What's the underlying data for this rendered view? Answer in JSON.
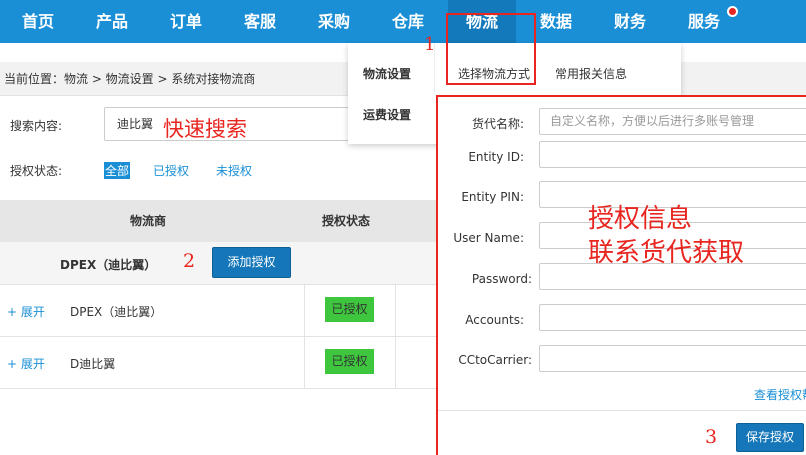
{
  "nav": {
    "items": [
      "首页",
      "产品",
      "订单",
      "客服",
      "采购",
      "仓库",
      "物流",
      "数据",
      "财务",
      "服务"
    ],
    "active_index": 6
  },
  "breadcrumb": "当前位置：物流 > 物流设置 > 系统对接物流商",
  "search": {
    "label": "搜索内容:",
    "value": "迪比翼"
  },
  "auth_filter": {
    "label": "授权状态:",
    "options": [
      "全部",
      "已授权",
      "未授权"
    ],
    "selected_index": 0
  },
  "table": {
    "headers": [
      "物流商",
      "授权状态"
    ],
    "group": {
      "name": "DPEX（迪比翼）",
      "add_button": "添加授权"
    },
    "rows": [
      {
        "expand": "+ 展开",
        "name": "DPEX（迪比翼）",
        "status": "已授权"
      },
      {
        "expand": "+ 展开",
        "name": "D迪比翼",
        "status": "已授权"
      }
    ]
  },
  "dropdown": {
    "col1": [
      "物流设置",
      "运费设置"
    ],
    "col2": [
      "选择物流方式",
      "常用报关信息"
    ]
  },
  "form": {
    "fields": [
      {
        "label": "货代名称:",
        "placeholder": "自定义名称，方便以后进行多账号管理"
      },
      {
        "label": "Entity ID:",
        "placeholder": ""
      },
      {
        "label": "Entity PIN:",
        "placeholder": ""
      },
      {
        "label": "User Name:",
        "placeholder": ""
      },
      {
        "label": "Password:",
        "placeholder": ""
      },
      {
        "label": "Accounts:",
        "placeholder": ""
      },
      {
        "label": "CCtoCarrier:",
        "placeholder": ""
      }
    ],
    "more_link": "查看授权帮",
    "save_button": "保存授权"
  },
  "annotations": {
    "search_note": "快速搜索",
    "auth_note_line1": "授权信息",
    "auth_note_line2": "联系货代获取",
    "step1": "1",
    "step2": "2",
    "step3": "3"
  },
  "colors": {
    "nav_bg": "#1a8fd6",
    "annotation_red": "#e8251f",
    "badge_green": "#3ec73e",
    "button_blue": "#1577b9"
  }
}
